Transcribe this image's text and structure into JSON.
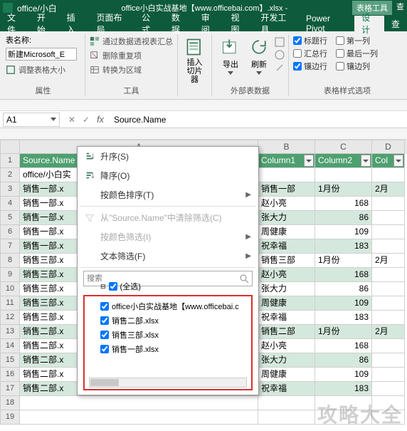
{
  "title": {
    "left": "office/小白",
    "center": "office小白实战基地【www.officebai.com】.xlsx -",
    "tool": "表格工具",
    "search": "查"
  },
  "menu": [
    "文件",
    "开始",
    "插入",
    "页面布局",
    "公式",
    "数据",
    "审阅",
    "视图",
    "开发工具",
    "Power Pivot",
    "设计",
    "查"
  ],
  "ribbon": {
    "name_label": "表名称:",
    "name_value": "新建Microsoft_E",
    "resize": "调整表格大小",
    "props": "属性",
    "pivot": "通过数据透视表汇总",
    "dedup": "删除重复项",
    "convert": "转换为区域",
    "tools": "工具",
    "slicer": "插入\n切片器",
    "export": "导出",
    "refresh": "刷新",
    "ext_data": "外部表数据",
    "chk_header": "标题行",
    "chk_first": "第一列",
    "chk_total": "汇总行",
    "chk_last": "最后一列",
    "chk_band_r": "镶边行",
    "chk_band_c": "镶边列",
    "style_opts": "表格样式选项"
  },
  "formula": {
    "ref": "A1",
    "value": "Source.Name"
  },
  "cols": {
    "a": "A",
    "b": "B",
    "c": "C",
    "d": "D"
  },
  "headers": {
    "a": "Source.Name",
    "b": "Column1",
    "c": "Column2",
    "d": "Col"
  },
  "rowsA": [
    "office/小白实",
    "销售一部.x",
    "销售一部.x",
    "销售一部.x",
    "销售一部.x",
    "销售一部.x",
    "销售三部.x",
    "销售三部.x",
    "销售三部.x",
    "销售三部.x",
    "销售三部.x",
    "销售二部.x",
    "销售二部.x",
    "销售二部.x",
    "销售二部.x",
    "销售二部.x"
  ],
  "dataBC": [
    {
      "b": "",
      "c": ""
    },
    {
      "b": "销售一部",
      "c": "1月份",
      "d": "2月"
    },
    {
      "b": "赵小亮",
      "c": "168"
    },
    {
      "b": "张大力",
      "c": "86"
    },
    {
      "b": "周健康",
      "c": "109"
    },
    {
      "b": "祝幸福",
      "c": "183"
    },
    {
      "b": "销售三部",
      "c": "1月份",
      "d": "2月"
    },
    {
      "b": "赵小亮",
      "c": "168"
    },
    {
      "b": "张大力",
      "c": "86"
    },
    {
      "b": "周健康",
      "c": "109"
    },
    {
      "b": "祝幸福",
      "c": "183"
    },
    {
      "b": "销售二部",
      "c": "1月份",
      "d": "2月"
    },
    {
      "b": "赵小亮",
      "c": "168"
    },
    {
      "b": "张大力",
      "c": "86"
    },
    {
      "b": "周健康",
      "c": "109"
    },
    {
      "b": "祝幸福",
      "c": "183"
    }
  ],
  "filter": {
    "asc": "升序(S)",
    "desc": "降序(O)",
    "by_color": "按颜色排序(T)",
    "clear": "从\"Source.Name\"中清除筛选(C)",
    "filter_color": "按颜色筛选(I)",
    "text_filter": "文本筛选(F)",
    "search_ph": "搜索",
    "all": "(全选)",
    "items": [
      "office小白实战基地【www.officebai.c",
      "销售二部.xlsx",
      "销售三部.xlsx",
      "销售一部.xlsx"
    ]
  },
  "watermark": "攻略大全"
}
